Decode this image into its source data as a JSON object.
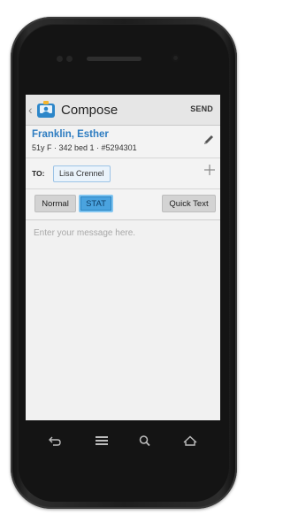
{
  "actionbar": {
    "title": "Compose",
    "send_label": "SEND",
    "icons": {
      "back": "chevron-left-icon",
      "app": "compose-app-icon"
    }
  },
  "patient": {
    "name": "Franklin, Esther",
    "details": "51y F · 342 bed 1 · #5294301",
    "edit_icon": "pencil-icon"
  },
  "recipients": {
    "to_label": "TO:",
    "chips": [
      "Lisa Crennel"
    ],
    "add_icon": "plus-icon"
  },
  "priority": {
    "normal_label": "Normal",
    "stat_label": "STAT",
    "selected": "STAT",
    "quick_text_label": "Quick Text"
  },
  "message": {
    "placeholder": "Enter your message here."
  },
  "navigation": {
    "icons": [
      "back-icon",
      "menu-icon",
      "search-icon",
      "home-icon"
    ]
  },
  "colors": {
    "accent": "#4aa3df",
    "name_blue": "#2d7cc1",
    "screen_bg": "#f1f1f1",
    "device_body": "#1d1d1d"
  }
}
